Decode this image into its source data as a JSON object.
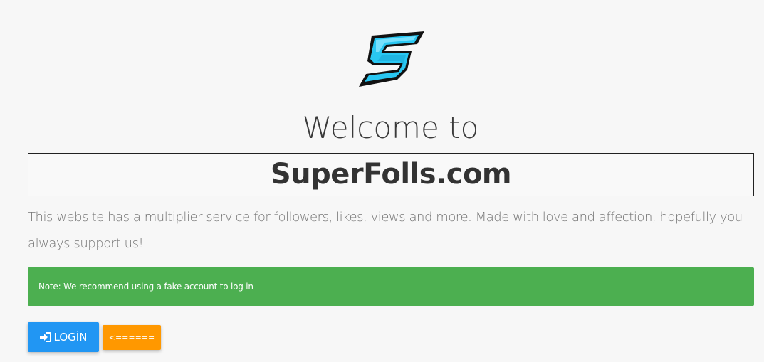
{
  "logo": {
    "icon": "superfolls-s-logo-icon",
    "colors": {
      "fill": "#29c7f2",
      "outline": "#111111"
    }
  },
  "hero": {
    "welcome": "Welcome to",
    "site_name": "SuperFolls.com",
    "description": "This website has a multiplier service for followers, likes, views and more. Made with love and affection, hopefully you always support us!"
  },
  "note": {
    "text": "Note: We recommend using a fake account to log in",
    "color": "#4caf50"
  },
  "buttons": {
    "login_label": "LOGİN",
    "login_icon": "sign-in-icon",
    "login_color": "#2196f3",
    "back_label": "<======",
    "back_color": "#ff9800"
  }
}
